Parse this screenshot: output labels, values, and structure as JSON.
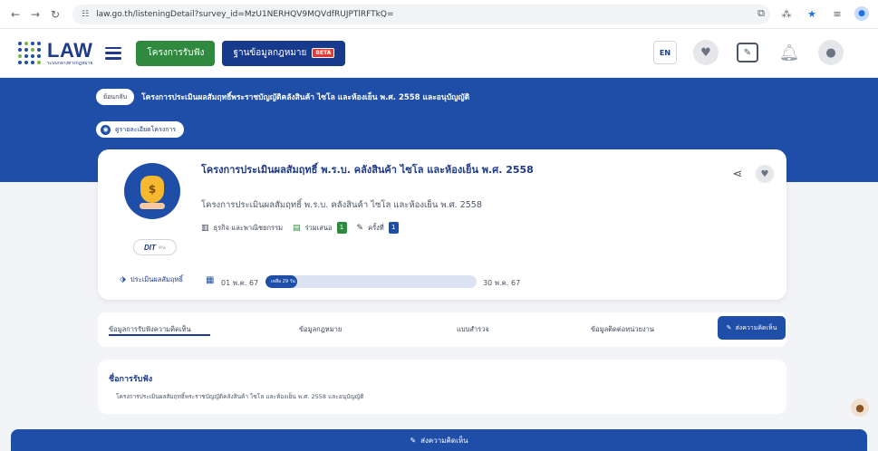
{
  "browser": {
    "url": "law.go.th/listeningDetail?survey_id=MzU1NERHQV9MQVdfRUJPTlRFTkQ="
  },
  "header": {
    "logo_text": "LAW",
    "logo_subtext": "ระบบกลางทางกฎหมาย",
    "btn_hearings": "โครงการรับฟัง",
    "btn_law_database": "ฐานข้อมูลกฎหมาย",
    "beta_badge": "BETA",
    "lang": "EN"
  },
  "breadcrumb": {
    "back_label": "ย้อนกลับ",
    "title": "โครงการประเมินผลสัมฤทธิ์พระราชบัญญัติคลังสินค้า ไซโล และห้องเย็น พ.ศ. 2558 และอนุบัญญัติ",
    "details_label": "ดูรายละเอียดโครงการ"
  },
  "project": {
    "title": "โครงการประเมินผลสัมฤทธิ์ พ.ร.บ. คลังสินค้า ไซโล และห้องเย็น พ.ศ. 2558",
    "subtitle": "โครงการประเมินผลสัมฤทธิ์ พ.ร.บ. คลังสินค้า ไซโล และห้องเย็น พ.ศ. 2558",
    "category": "ธุรกิจ และพาณิชยกรรม",
    "participants_label": "ร่วมเสนอ",
    "participants_count": "1",
    "round_label": "ครั้งที่",
    "round_count": "1",
    "agency_badge": "DIT",
    "agency_suffix": "คน",
    "type_tag": "ประเมินผลสัมฤทธิ์",
    "date_start": "01 พ.ค. 67",
    "date_end": "30 พ.ค. 67",
    "progress_text": "เหลือ 29 วัน",
    "progress_fraction": 0.15
  },
  "tabs": [
    {
      "label": "ข้อมูลการรับฟังความคิดเห็น"
    },
    {
      "label": "ข้อมูลกฎหมาย"
    },
    {
      "label": "แบบสำรวจ"
    },
    {
      "label": "ข้อมูลติดต่อหน่วยงาน"
    }
  ],
  "comment_button": "ส่งความคิดเห็น",
  "info": {
    "heading": "ชื่อการรับฟัง",
    "text": "โครงการประเมินผลสัมฤทธิ์พระราชบัญญัติคลังสินค้า ไซโล และห้องเย็น พ.ศ. 2558 และอนุบัญญัติ"
  },
  "bottom_bar": {
    "label": "ส่งความคิดเห็น"
  }
}
